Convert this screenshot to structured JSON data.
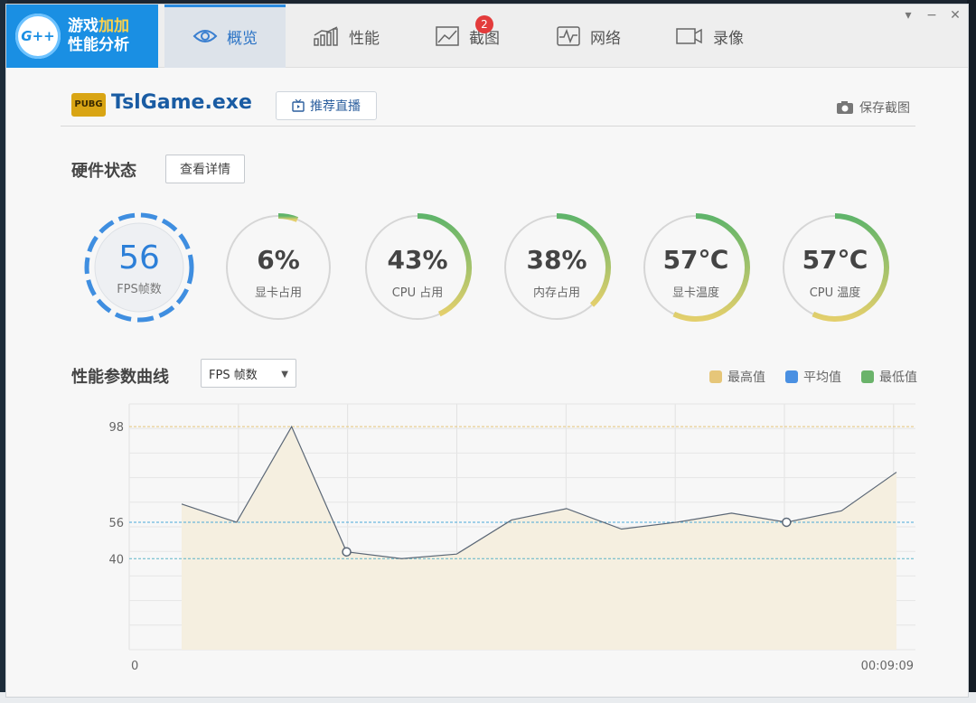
{
  "brand": {
    "logo_text": "G++",
    "line1_a": "游戏",
    "line1_b": "加加",
    "line2": "性能分析"
  },
  "tabs": [
    {
      "label": "概览",
      "icon": "eye-icon",
      "active": true
    },
    {
      "label": "性能",
      "icon": "bar-chart-icon",
      "active": false
    },
    {
      "label": "截图",
      "icon": "image-icon",
      "active": false,
      "badge": "2"
    },
    {
      "label": "网络",
      "icon": "pulse-icon",
      "active": false
    },
    {
      "label": "录像",
      "icon": "video-icon",
      "active": false
    }
  ],
  "window_controls": {
    "menu": "▾",
    "minimize": "−",
    "close": "✕"
  },
  "game": {
    "icon_text": "PUBG",
    "name": "TslGame.exe",
    "recommend_label": "推荐直播",
    "save_label": "保存截图"
  },
  "hardware": {
    "title": "硬件状态",
    "detail_label": "查看详情",
    "gauges": [
      {
        "value": "56",
        "label": "FPS帧数",
        "fraction": 1.0
      },
      {
        "value": "6%",
        "label": "显卡占用",
        "fraction": 0.06
      },
      {
        "value": "43%",
        "label": "CPU 占用",
        "fraction": 0.43
      },
      {
        "value": "38%",
        "label": "内存占用",
        "fraction": 0.38
      },
      {
        "value": "57℃",
        "label": "显卡温度",
        "fraction": 0.57
      },
      {
        "value": "57℃",
        "label": "CPU 温度",
        "fraction": 0.57
      }
    ]
  },
  "curve": {
    "title": "性能参数曲线",
    "select_value": "FPS 帧数",
    "legend": [
      {
        "label": "最高值",
        "color": "#e6c679"
      },
      {
        "label": "平均值",
        "color": "#4a90e2"
      },
      {
        "label": "最低值",
        "color": "#6ab36a"
      }
    ]
  },
  "chart_data": {
    "type": "area",
    "y_ticks": [
      "98",
      "56",
      "40"
    ],
    "x_start_label": "0",
    "x_end_label": "00:09:09",
    "ylim": [
      0,
      108
    ],
    "reference_lines": {
      "max": 98,
      "avg": 56,
      "min": 40
    },
    "values": [
      64,
      56,
      98,
      43,
      40,
      42,
      57,
      62,
      53,
      56,
      60,
      56,
      61,
      78
    ],
    "markers": [
      3,
      11
    ],
    "colors": {
      "line": "#5b6776",
      "fill": "#f5efe0",
      "max": "#e6c679",
      "avg": "#4aa8d8",
      "min": "#5cb3c8"
    }
  }
}
